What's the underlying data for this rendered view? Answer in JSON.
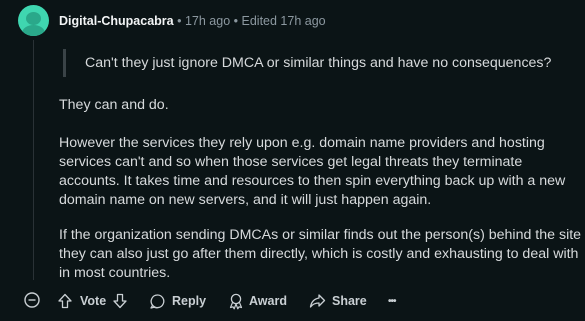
{
  "comment": {
    "author": "Digital-Chupacabra",
    "separator": "•",
    "time": "17h ago",
    "edited": "Edited 17h ago",
    "quote": "Can't they just ignore DMCA or similar things and have no consequences?",
    "paragraphs": [
      "They can and do.",
      "However the services they rely upon e.g. domain name providers and hosting services can't and so when those services get legal threats they terminate accounts. It takes time and resources to then spin everything back up with a new domain name on new servers, and it will just happen again.",
      "If the organization sending DMCAs or similar finds out the person(s) behind the site they can also just go after them directly, which is costly and exhausting to deal with in most countries."
    ]
  },
  "actions": {
    "vote_label": "Vote",
    "reply_label": "Reply",
    "award_label": "Award",
    "share_label": "Share",
    "more_label": "•••"
  },
  "icons": {
    "collapse": "collapse-minus-icon",
    "upvote": "upvote-arrow-icon",
    "downvote": "downvote-arrow-icon",
    "reply": "comment-bubble-icon",
    "award": "award-icon",
    "share": "share-arrow-icon"
  },
  "colors": {
    "background": "#0b1416",
    "avatar": "#3fd6b0",
    "text": "#d7dadc",
    "meta": "#8c98a0"
  }
}
